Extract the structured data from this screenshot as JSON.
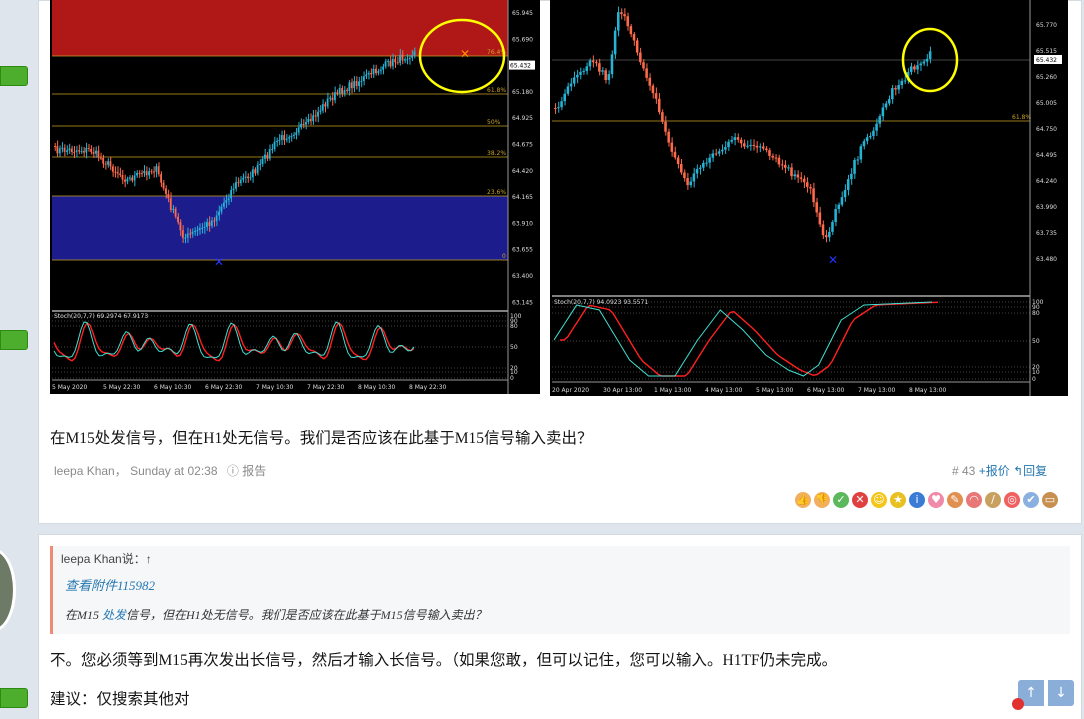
{
  "left_chart": {
    "price_labels": [
      "65.945",
      "65.690",
      "65.432",
      "65.180",
      "64.925",
      "64.675",
      "64.420",
      "64.165",
      "63.910",
      "63.655",
      "63.400",
      "63.145"
    ],
    "current_price": "65.432",
    "fib_labels": [
      "76.4%",
      "61.8%",
      "50%",
      "38.2%",
      "23.6%",
      "0"
    ],
    "stoch_label": "Stoch(20,7,7) 69.2974 67.9173",
    "stoch_levels": [
      "100",
      "90",
      "80",
      "50",
      "20",
      "10",
      "0"
    ],
    "time_labels": [
      "5 May 2020",
      "5 May 22:30",
      "6 May 10:30",
      "6 May 22:30",
      "7 May 10:30",
      "7 May 22:30",
      "8 May 10:30",
      "8 May 22:30"
    ]
  },
  "right_chart": {
    "price_labels": [
      "65.770",
      "65.515",
      "65.260",
      "65.005",
      "64.750",
      "64.495",
      "64.240",
      "63.990",
      "63.735",
      "63.480"
    ],
    "current_price": "65.432",
    "fib_labels": [
      "61.8%"
    ],
    "stoch_label": "Stoch(20,7,7) 94.0923 93.5571",
    "stoch_levels": [
      "100",
      "90",
      "80",
      "50",
      "20",
      "10",
      "0"
    ],
    "time_labels": [
      "20 Apr 2020",
      "30 Apr 13:00",
      "1 May 13:00",
      "4 May 13:00",
      "5 May 13:00",
      "6 May 13:00",
      "7 May 13:00",
      "8 May 13:00"
    ]
  },
  "post1": {
    "body": "在M15处发信号，但在H1处无信号。我们是否应该在此基于M15信号输入卖出？",
    "author": "leepa Khan",
    "separator": "，",
    "time": "Sunday at 02:38",
    "report": "报告",
    "number": "# 43",
    "offer": "+报价",
    "reply": "回复"
  },
  "quote": {
    "author_line": "leepa Khan说：↑",
    "attachment": "查看附件115982",
    "text_before": "在M15 ",
    "text_link": "处发",
    "text_after": "信号，但在H1处无信号。我们是否应该在此基于M15信号输入卖出？"
  },
  "post2": {
    "line1": "不。您必须等到M15再次发出长信号，然后才输入长信号。（如果您敢，但可以记住，您可以输入。H1TF仍未完成。",
    "line2": "建议：仅搜索其他对"
  },
  "colors": {
    "bull": "#26b4d6",
    "bear": "#ff6a4a",
    "fib": "#c9a227",
    "redzone": "#b01818",
    "bluezone": "#1a1a8a"
  }
}
